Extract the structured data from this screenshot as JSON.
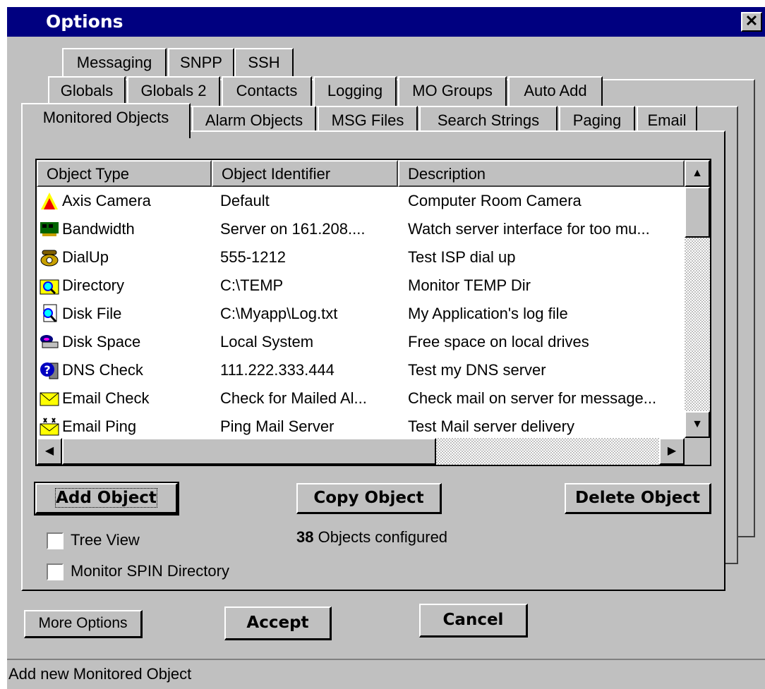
{
  "window": {
    "title": "Options",
    "close_glyph": "✕"
  },
  "tabs": {
    "row1": [
      "Messaging",
      "SNPP",
      "SSH"
    ],
    "row2": [
      "Globals",
      "Globals 2",
      "Contacts",
      "Logging",
      "MO Groups",
      "Auto Add"
    ],
    "row3": [
      "Monitored Objects",
      "Alarm Objects",
      "MSG Files",
      "Search Strings",
      "Paging",
      "Email"
    ],
    "active": "Monitored Objects"
  },
  "list": {
    "columns": [
      "Object Type",
      "Object Identifier",
      "Description"
    ],
    "rows": [
      {
        "type": "Axis Camera",
        "id": "Default",
        "desc": "Computer Room Camera",
        "icon": "camera-icon"
      },
      {
        "type": "Bandwidth",
        "id": "Server on 161.208....",
        "desc": "Watch server interface for too mu...",
        "icon": "network-card-icon"
      },
      {
        "type": "DialUp",
        "id": "555-1212",
        "desc": "Test ISP dial up",
        "icon": "telephone-icon"
      },
      {
        "type": "Directory",
        "id": "C:\\TEMP",
        "desc": "Monitor TEMP Dir",
        "icon": "folder-search-icon"
      },
      {
        "type": "Disk File",
        "id": "C:\\Myapp\\Log.txt",
        "desc": "My Application's log file",
        "icon": "file-search-icon"
      },
      {
        "type": "Disk Space",
        "id": "Local System",
        "desc": "Free space on local drives",
        "icon": "disk-drive-icon"
      },
      {
        "type": "DNS Check",
        "id": "111.222.333.444",
        "desc": "Test my DNS server",
        "icon": "dns-question-icon"
      },
      {
        "type": "Email Check",
        "id": "Check for Mailed Al...",
        "desc": "Check mail on server for message...",
        "icon": "envelope-icon"
      },
      {
        "type": "Email Ping",
        "id": "Ping Mail Server",
        "desc": "Test Mail server delivery",
        "icon": "envelope-ping-icon"
      }
    ]
  },
  "buttons": {
    "add": "Add Object",
    "copy": "Copy Object",
    "delete": "Delete Object",
    "more": "More Options",
    "accept": "Accept",
    "cancel": "Cancel"
  },
  "checkboxes": {
    "tree_view": "Tree View",
    "monitor_spin": "Monitor SPIN Directory"
  },
  "count": {
    "number": "38",
    "label": "Objects configured"
  },
  "status": "Add new Monitored Object",
  "colors": {
    "title_bar": "#000080",
    "face": "#c0c0c0"
  }
}
